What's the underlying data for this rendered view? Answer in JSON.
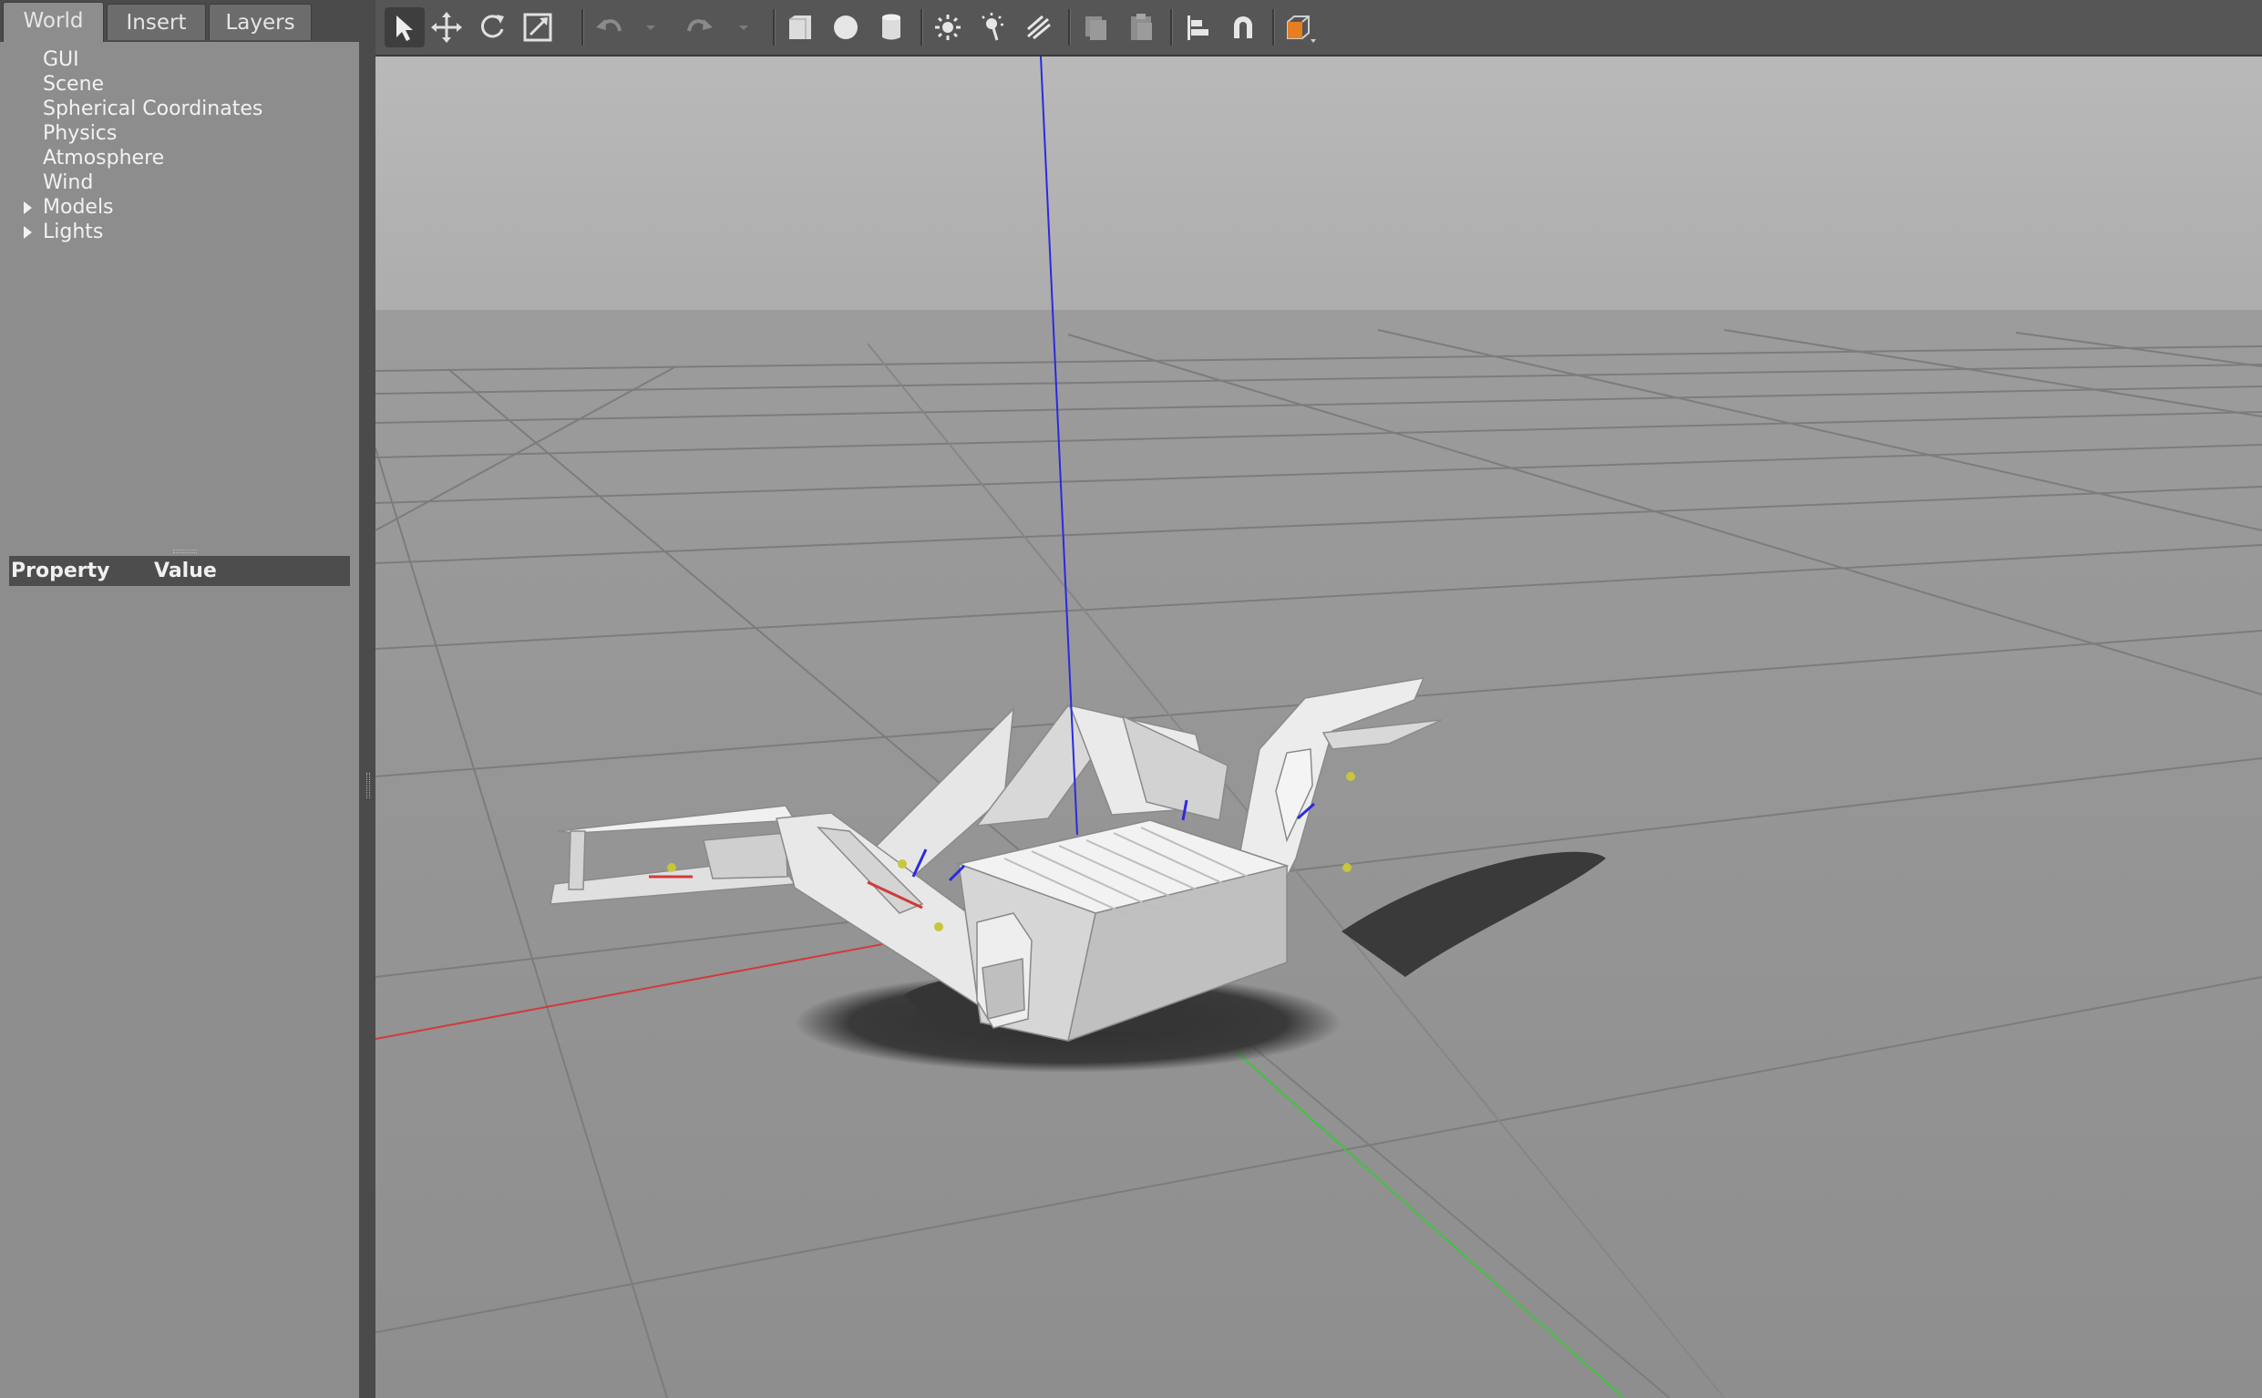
{
  "left_panel": {
    "tabs": [
      {
        "label": "World",
        "active": true
      },
      {
        "label": "Insert",
        "active": false
      },
      {
        "label": "Layers",
        "active": false
      }
    ],
    "tree": [
      {
        "label": "GUI",
        "expandable": false
      },
      {
        "label": "Scene",
        "expandable": false
      },
      {
        "label": "Spherical Coordinates",
        "expandable": false
      },
      {
        "label": "Physics",
        "expandable": false
      },
      {
        "label": "Atmosphere",
        "expandable": false
      },
      {
        "label": "Wind",
        "expandable": false
      },
      {
        "label": "Models",
        "expandable": true
      },
      {
        "label": "Lights",
        "expandable": true
      }
    ],
    "properties": {
      "col_property": "Property",
      "col_value": "Value"
    }
  },
  "toolbar": {
    "tools": [
      {
        "icon": "select-arrow-icon",
        "active": true
      },
      {
        "icon": "translate-icon"
      },
      {
        "icon": "rotate-icon"
      },
      {
        "icon": "scale-icon"
      },
      {
        "icon": "undo-icon",
        "enabled": false
      },
      {
        "icon": "redo-icon",
        "enabled": false
      },
      {
        "icon": "box-icon"
      },
      {
        "icon": "sphere-icon"
      },
      {
        "icon": "cylinder-icon"
      },
      {
        "icon": "point-light-icon"
      },
      {
        "icon": "spot-light-icon"
      },
      {
        "icon": "directional-light-icon"
      },
      {
        "icon": "copy-icon",
        "enabled": false
      },
      {
        "icon": "paste-icon",
        "enabled": false
      },
      {
        "icon": "align-icon"
      },
      {
        "icon": "snap-magnet-icon"
      },
      {
        "icon": "view-angle-icon"
      }
    ]
  },
  "viewport": {
    "scene": "3D simulation view with a gray tracked robot with folding flippers on a ground grid",
    "axis_colors": {
      "x": "#d23a3a",
      "y": "#3fc43f",
      "z": "#2a2ae0"
    },
    "sky_color": "#b4b4b4",
    "ground_color": "#8f8f8f"
  }
}
